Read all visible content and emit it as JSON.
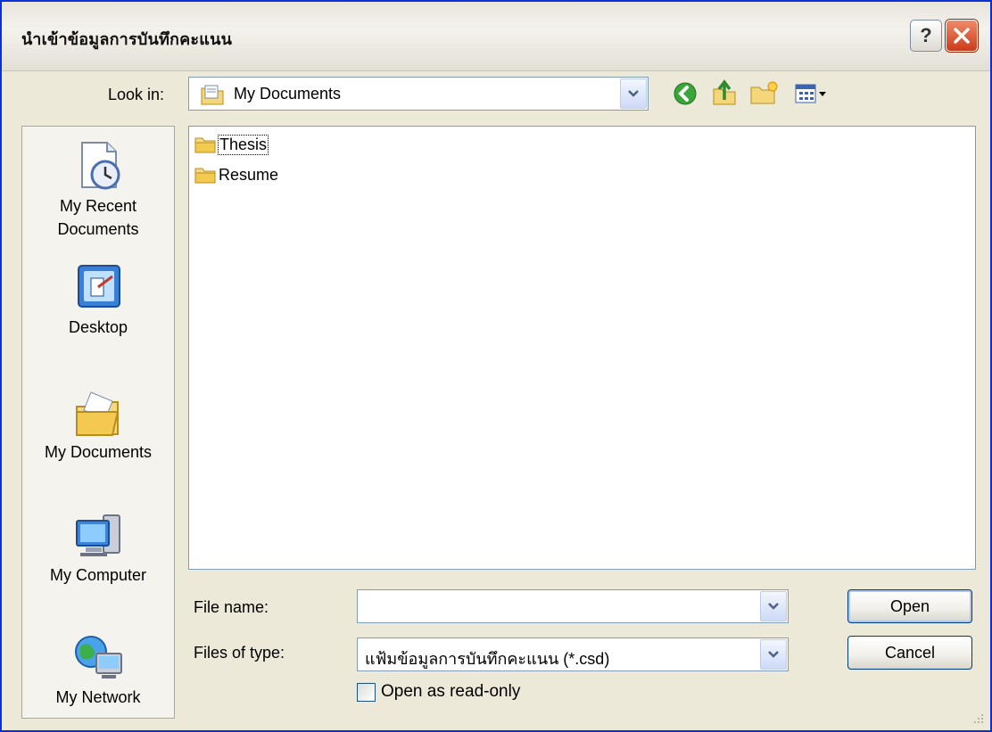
{
  "window": {
    "title": "นำเข้าข้อมูลการบันทึกคะแนน",
    "help_glyph": "?",
    "accent_color": "#0831d9"
  },
  "toolbar": {
    "look_in_label": "Look in:",
    "look_in_value": "My Documents",
    "buttons": [
      "back-icon",
      "up-folder-icon",
      "new-folder-icon",
      "views-menu-icon"
    ]
  },
  "places": [
    {
      "label": "My Recent Documents",
      "icon": "recent-documents-icon"
    },
    {
      "label": "Desktop",
      "icon": "desktop-icon"
    },
    {
      "label": "My Documents",
      "icon": "my-documents-icon"
    },
    {
      "label": "My Computer",
      "icon": "my-computer-icon"
    },
    {
      "label": "My Network",
      "icon": "my-network-icon"
    }
  ],
  "files": [
    {
      "name": "Thesis",
      "icon": "folder-icon"
    },
    {
      "name": "Resume",
      "icon": "folder-icon"
    }
  ],
  "form": {
    "file_name_label": "File name:",
    "file_name_value": "",
    "file_type_label": "Files of type:",
    "file_type_value": "แฟ้มข้อมูลการบันทึกคะแนน (*.csd)",
    "read_only_label": "Open as read-only",
    "read_only_checked": false
  },
  "buttons": {
    "open": "Open",
    "cancel": "Cancel"
  }
}
